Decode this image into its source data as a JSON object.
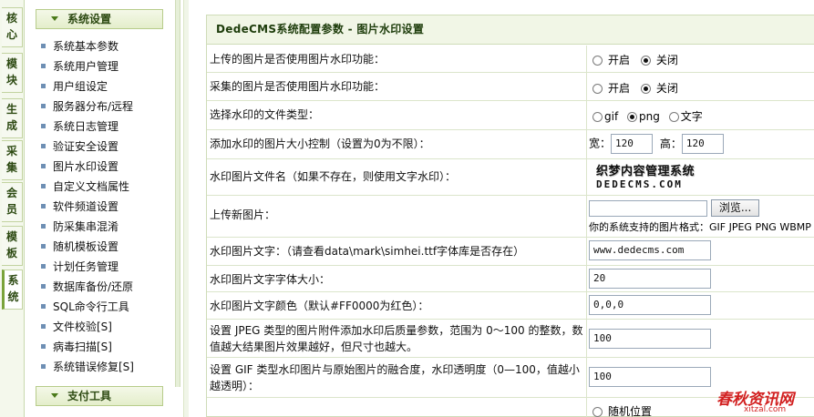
{
  "vertical_tabs": [
    "核心",
    "模块",
    "生成",
    "采集",
    "会员",
    "模板",
    "系统"
  ],
  "sidebar": {
    "section_title": "系统设置",
    "items": [
      "系统基本参数",
      "系统用户管理",
      "用户组设定",
      "服务器分布/远程",
      "系统日志管理",
      "验证安全设置",
      "图片水印设置",
      "自定义文档属性",
      "软件频道设置",
      "防采集串混淆",
      "随机模板设置",
      "计划任务管理",
      "数据库备份/还原",
      "SQL命令行工具",
      "文件校验[S]",
      "病毒扫描[S]",
      "系统错误修复[S]"
    ],
    "section2_title": "支付工具"
  },
  "main": {
    "title": "DedeCMS系统配置参数 - 图片水印设置",
    "rows": {
      "upload_watermark": {
        "label": "上传的图片是否使用图片水印功能：",
        "opt_on": "开启",
        "opt_off": "关闭",
        "selected": "关闭"
      },
      "collect_watermark": {
        "label": "采集的图片是否使用图片水印功能：",
        "opt_on": "开启",
        "opt_off": "关闭",
        "selected": "关闭"
      },
      "file_type": {
        "label": "选择水印的文件类型：",
        "opt_gif": "gif",
        "opt_png": "png",
        "opt_text": "文字",
        "selected": "png"
      },
      "size_control": {
        "label": "添加水印的图片大小控制（设置为0为不限）：",
        "width_label": "宽：",
        "width_value": "120",
        "height_label": "高：",
        "height_value": "120"
      },
      "image_file": {
        "label": "水印图片文件名（如果不存在，则使用文字水印）：",
        "image_line1": "织梦内容管理系统",
        "image_line2": "DEDECMS.COM"
      },
      "upload_new": {
        "label": "上传新图片：",
        "browse_label": "浏览...",
        "formats_text": "你的系统支持的图片格式：GIF JPEG PNG WBMP"
      },
      "text": {
        "label": "水印图片文字：（请查看data\\mark\\simhei.ttf字体库是否存在）",
        "value": "www.dedecms.com"
      },
      "font_size": {
        "label": "水印图片文字字体大小：",
        "value": "20"
      },
      "font_color": {
        "label": "水印图片文字颜色（默认#FF0000为红色）：",
        "value": "0,0,0"
      },
      "jpeg_quality": {
        "label": "设置 JPEG 类型的图片附件添加水印后质量参数，范围为 0～100 的整数，数值越大结果图片效果越好，但尺寸也越大。",
        "value": "100"
      },
      "gif_transparency": {
        "label": "设置 GIF 类型水印图片与原始图片的融合度，水印透明度（0—100，值越小越透明）：",
        "value": "100"
      },
      "position": {
        "opt_random": "随机位置"
      }
    }
  },
  "watermark_site": {
    "line1": "春秋资讯网",
    "line2": "xitzal.com"
  },
  "colors": {
    "accent_green": "#4b7a1a",
    "header_bg": "#f1f6e6",
    "border": "#cfdcb8",
    "watermark_red": "#d22020"
  }
}
